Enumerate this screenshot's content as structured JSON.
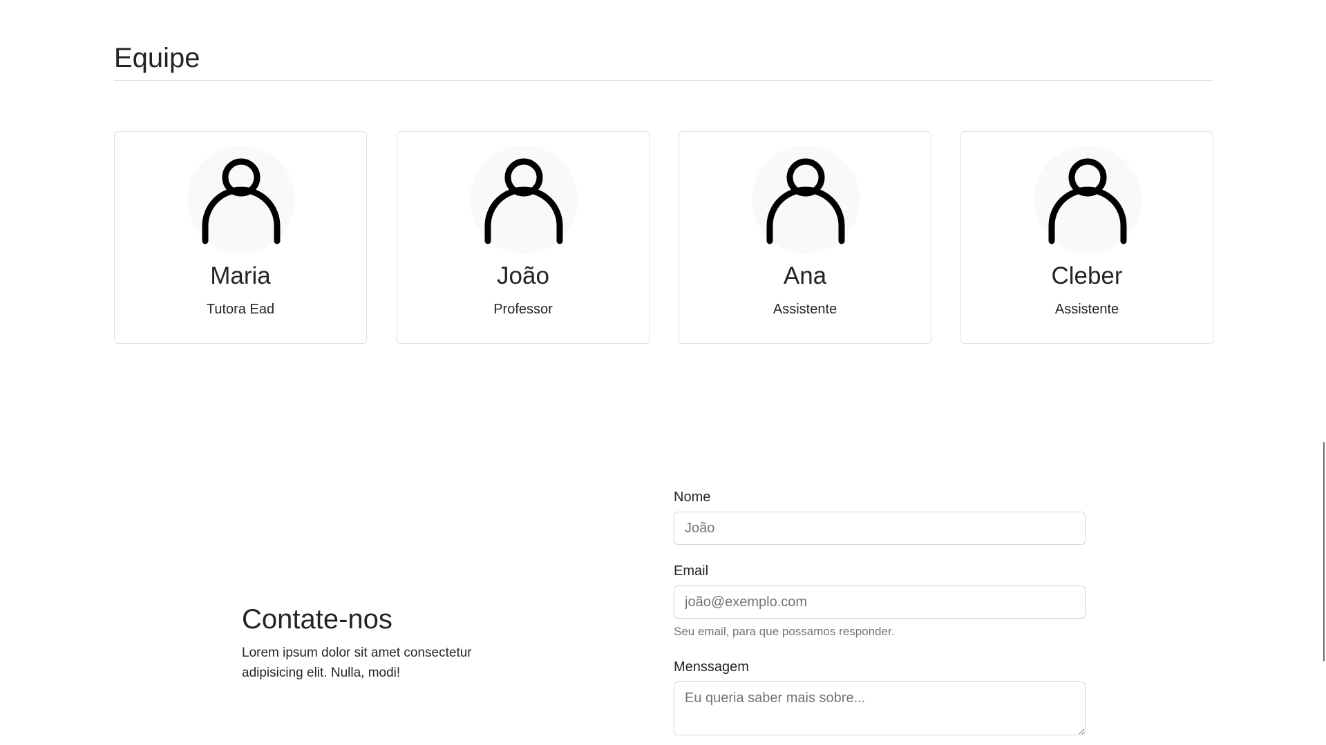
{
  "team": {
    "title": "Equipe",
    "members": [
      {
        "name": "Maria",
        "role": "Tutora Ead",
        "icon": "person-icon"
      },
      {
        "name": "João",
        "role": "Professor",
        "icon": "person-icon"
      },
      {
        "name": "Ana",
        "role": "Assistente",
        "icon": "person-icon"
      },
      {
        "name": "Cleber",
        "role": "Assistente",
        "icon": "person-icon"
      }
    ]
  },
  "contact": {
    "title": "Contate-nos",
    "text": "Lorem ipsum dolor sit amet consectetur adipisicing elit. Nulla, modi!"
  },
  "form": {
    "name_label": "Nome",
    "name_value": "",
    "name_placeholder": "João",
    "email_label": "Email",
    "email_value": "",
    "email_placeholder": "joão@exemplo.com",
    "email_help": "Seu email, para que possamos responder.",
    "message_label": "Menssagem",
    "message_value": "",
    "message_placeholder": "Eu queria saber mais sobre..."
  }
}
